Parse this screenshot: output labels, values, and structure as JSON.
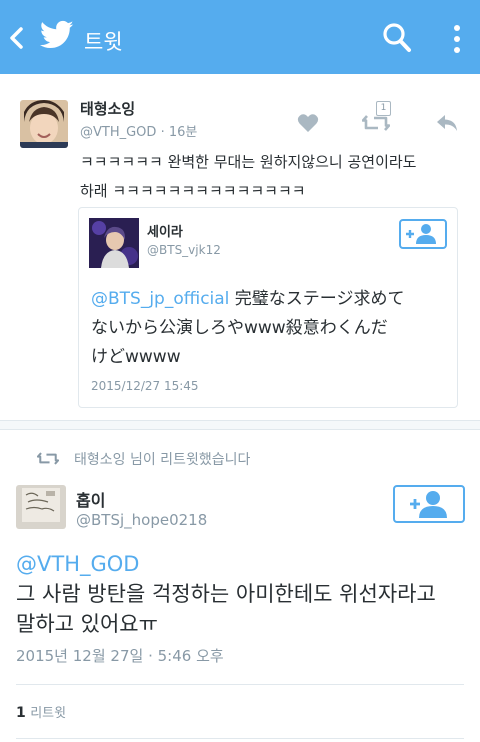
{
  "header": {
    "title": "트윗",
    "back_icon": "back-arrow-icon",
    "logo_icon": "twitter-bird-icon",
    "search_icon": "search-icon",
    "more_icon": "more-vertical-icon",
    "bar_color": "#55acee"
  },
  "reply_tweet": {
    "display_name": "태형소잉",
    "handle": "@VTH_GOD",
    "separator": "·",
    "time_ago": "16분",
    "text_line1": "ㅋㅋㅋㅋㅋㅋ 완벽한 무대는 원하지않으니 공연이라도",
    "text_line2": "하래 ㅋㅋㅋㅋㅋㅋㅋㅋㅋㅋㅋㅋㅋㅋ",
    "retweet_badge": "1",
    "actions": [
      "heart-icon",
      "retweet-icon",
      "reply-icon"
    ]
  },
  "quoted_tweet": {
    "display_name": "세이라",
    "handle": "@BTS_vjk12",
    "mention": "@BTS_jp_official",
    "text_after_mention": " 完璧なステージ求めて",
    "text_line2": "ないから公演しろやwww殺意わくんだ",
    "text_line3": "けどwwww",
    "timestamp": "2015/12/27 15:45"
  },
  "retweet_context": {
    "text": "태형소잉 님이 리트윗했습니다"
  },
  "main_tweet": {
    "display_name": "홉이",
    "handle": "@BTSj_hope0218",
    "reply_mention": "@VTH_GOD",
    "text_line1": "그 사람 방탄을 걱정하는 아미한테도 위선자라고",
    "text_line2": "말하고 있어요ㅠ",
    "date": "2015년 12월 27일",
    "separator": "·",
    "time": "5:46 오후",
    "retweet_count": "1",
    "retweet_label": "리트윗"
  },
  "colors": {
    "accent": "#55acee",
    "muted": "#8899a6",
    "text": "#292f33",
    "border": "#e1e8ed"
  }
}
